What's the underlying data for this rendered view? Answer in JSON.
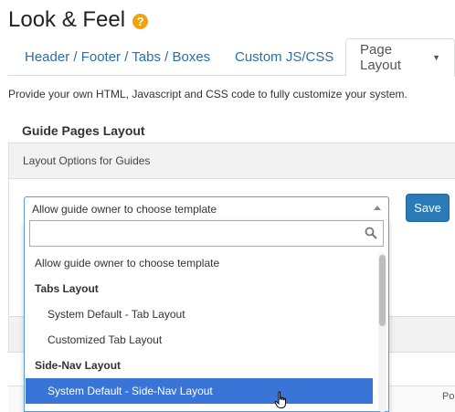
{
  "header": {
    "title": "Look & Feel",
    "help_icon": "question-circle-icon",
    "help_glyph": "?"
  },
  "tabs": [
    {
      "label": "Header / Footer / Tabs / Boxes",
      "active": false
    },
    {
      "label": "Custom JS/CSS",
      "active": false
    },
    {
      "label": "Page Layout",
      "active": true,
      "has_caret": true
    }
  ],
  "description": "Provide your own HTML, Javascript and CSS code to fully customize your system.",
  "section": {
    "title": "Guide Pages Layout",
    "panel_title": "Layout Options for Guides"
  },
  "select": {
    "value": "Allow guide owner to choose template",
    "search_placeholder": "",
    "options": [
      {
        "label": "Allow guide owner to choose template",
        "kind": "plain"
      },
      {
        "label": "Tabs Layout",
        "kind": "group"
      },
      {
        "label": "System Default - Tab Layout",
        "kind": "option"
      },
      {
        "label": "Customized Tab Layout",
        "kind": "option"
      },
      {
        "label": "Side-Nav Layout",
        "kind": "group"
      },
      {
        "label": "System Default - Side-Nav Layout",
        "kind": "option",
        "highlighted": true
      }
    ]
  },
  "save_label": "Save",
  "footer_fragment": "Po",
  "colors": {
    "accent": "#2a7ab8",
    "highlight": "#3875d7",
    "help": "#f0a30a",
    "link": "#2a6fa8"
  }
}
